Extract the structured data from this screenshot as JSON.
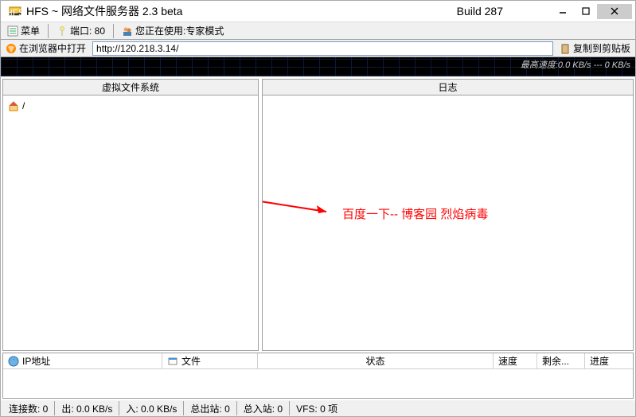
{
  "titlebar": {
    "title": "HFS ~ 网络文件服务器 2.3 beta",
    "build": "Build 287"
  },
  "toolbar": {
    "menu": "菜单",
    "port_label": "端口: 80",
    "mode_label": "您正在使用:专家模式"
  },
  "addrbar": {
    "open_label": "在浏览器中打开",
    "url": "http://120.218.3.14/",
    "copy_label": "复制到剪贴板"
  },
  "speedbar": {
    "text": "最高速度:0.0 KB/s --- 0 KB/s"
  },
  "panels": {
    "vfs_header": "虚拟文件系统",
    "log_header": "日志",
    "vfs_root": "/"
  },
  "annotation": {
    "text": "百度一下--  博客园 烈焰病毒"
  },
  "conn": {
    "cols": {
      "ip": "IP地址",
      "file": "文件",
      "status": "状态",
      "speed": "速度",
      "remaining": "剩余...",
      "progress": "进度"
    }
  },
  "statusbar": {
    "connections": "连接数: 0",
    "out": "出: 0.0 KB/s",
    "in": "入: 0.0 KB/s",
    "total_out": "总出站: 0",
    "total_in": "总入站: 0",
    "vfs": "VFS: 0 项"
  }
}
